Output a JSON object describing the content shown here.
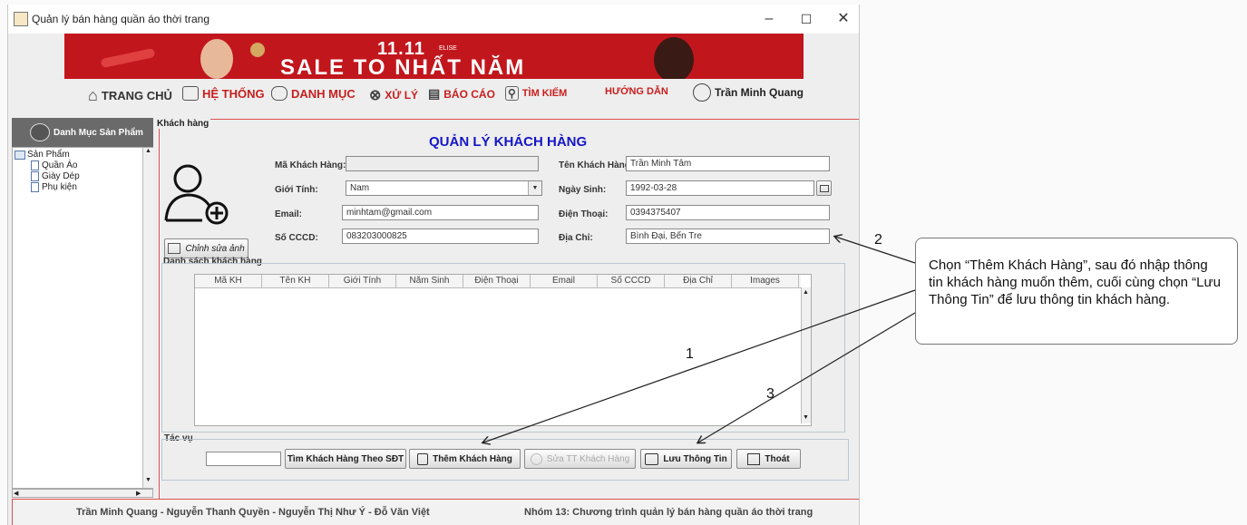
{
  "window": {
    "title": "Quản lý bán hàng quần áo thời trang"
  },
  "banner": {
    "line1": "11.11",
    "line2": "SALE TO NHẤT NĂM",
    "brand": "ELISE"
  },
  "menu": {
    "home": "TRANG CHỦ",
    "system": "HỆ THỐNG",
    "catalog": "DANH MỤC",
    "process": "XỬ LÝ",
    "report": "BÁO CÁO",
    "search": "TÌM KIẾM",
    "guide": "HƯỚNG DẪN",
    "user": "Trần Minh Quang"
  },
  "sidebar": {
    "title": "Danh Mục Sản Phẩm",
    "root": "Sản Phẩm",
    "items": [
      {
        "label": "Quần Áo"
      },
      {
        "label": "Giày Dép"
      },
      {
        "label": "Phụ kiện"
      }
    ]
  },
  "panel": {
    "title": "Khách hàng",
    "heading": "QUẢN LÝ KHÁCH HÀNG"
  },
  "form": {
    "id_label": "Mã Khách Hàng:",
    "id_value": "",
    "name_label": "Tên Khách Hàng:",
    "name_value": "Trần Minh Tâm",
    "gender_label": "Giới Tính:",
    "gender_value": "Nam",
    "dob_label": "Ngày Sinh:",
    "dob_value": "1992-03-28",
    "email_label": "Email:",
    "email_value": "minhtam@gmail.com",
    "phone_label": "Điện Thoại:",
    "phone_value": "0394375407",
    "cccd_label": "Số CCCD:",
    "cccd_value": "083203000825",
    "address_label": "Địa Chỉ:",
    "address_value": "Bình Đại, Bến Tre",
    "edit_image": "Chỉnh sửa ảnh"
  },
  "table": {
    "title": "Danh sách khách hàng",
    "columns": [
      "Mã KH",
      "Tên KH",
      "Giới Tính",
      "Năm Sinh",
      "Điện Thoại",
      "Email",
      "Số CCCD",
      "Địa Chỉ",
      "Images"
    ]
  },
  "actions": {
    "title": "Tác vụ",
    "search_value": "",
    "find": "Tìm Khách Hàng Theo SĐT",
    "add": "Thêm Khách Hàng",
    "edit": "Sửa TT Khách Hàng",
    "save": "Lưu Thông Tin",
    "exit": "Thoát"
  },
  "footer": {
    "authors": "Trần Minh Quang - Nguyễn Thanh Quyền - Nguyễn Thị Như Ý - Đỗ Văn Việt",
    "group": "Nhóm 13: Chương trình quản lý bán hàng quần áo thời trang"
  },
  "annotation": {
    "callout": "Chọn “Thêm Khách Hàng”, sau đó nhập thông tin khách hàng muốn thêm, cuối cùng chọn “Lưu Thông Tin” để lưu thông tin khách hàng.",
    "step1": "1",
    "step2": "2",
    "step3": "3"
  },
  "colors": {
    "heading": "#1515c8",
    "banner": "#c2161d",
    "menu_red": "#c81e1e",
    "frame_red": "#e05050"
  }
}
